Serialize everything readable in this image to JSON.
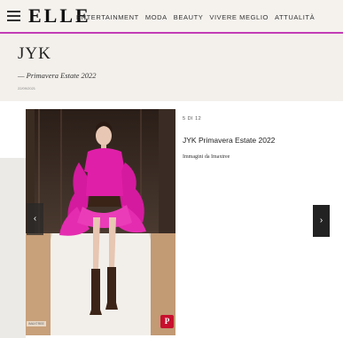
{
  "header": {
    "logo": "ELLE",
    "nav": [
      "ENTERTAINMENT",
      "MODA",
      "BEAUTY",
      "VIVERE MEGLIO",
      "ATTUALITÀ"
    ]
  },
  "article": {
    "title": "JYK",
    "subtitle": "— Primavera Estate 2022",
    "date": "22/09/2021"
  },
  "gallery": {
    "counter": "5 DI 12",
    "slide_title": "JYK Primavera Estate 2022",
    "credit": "Immagini da Imaxtree",
    "watermark": "IMAXTREE",
    "prev_icon": "‹",
    "next_icon": "›",
    "pin_icon": "P"
  },
  "colors": {
    "accent": "#c23db6",
    "dress": "#e01fa8",
    "pinterest": "#c8102e"
  }
}
